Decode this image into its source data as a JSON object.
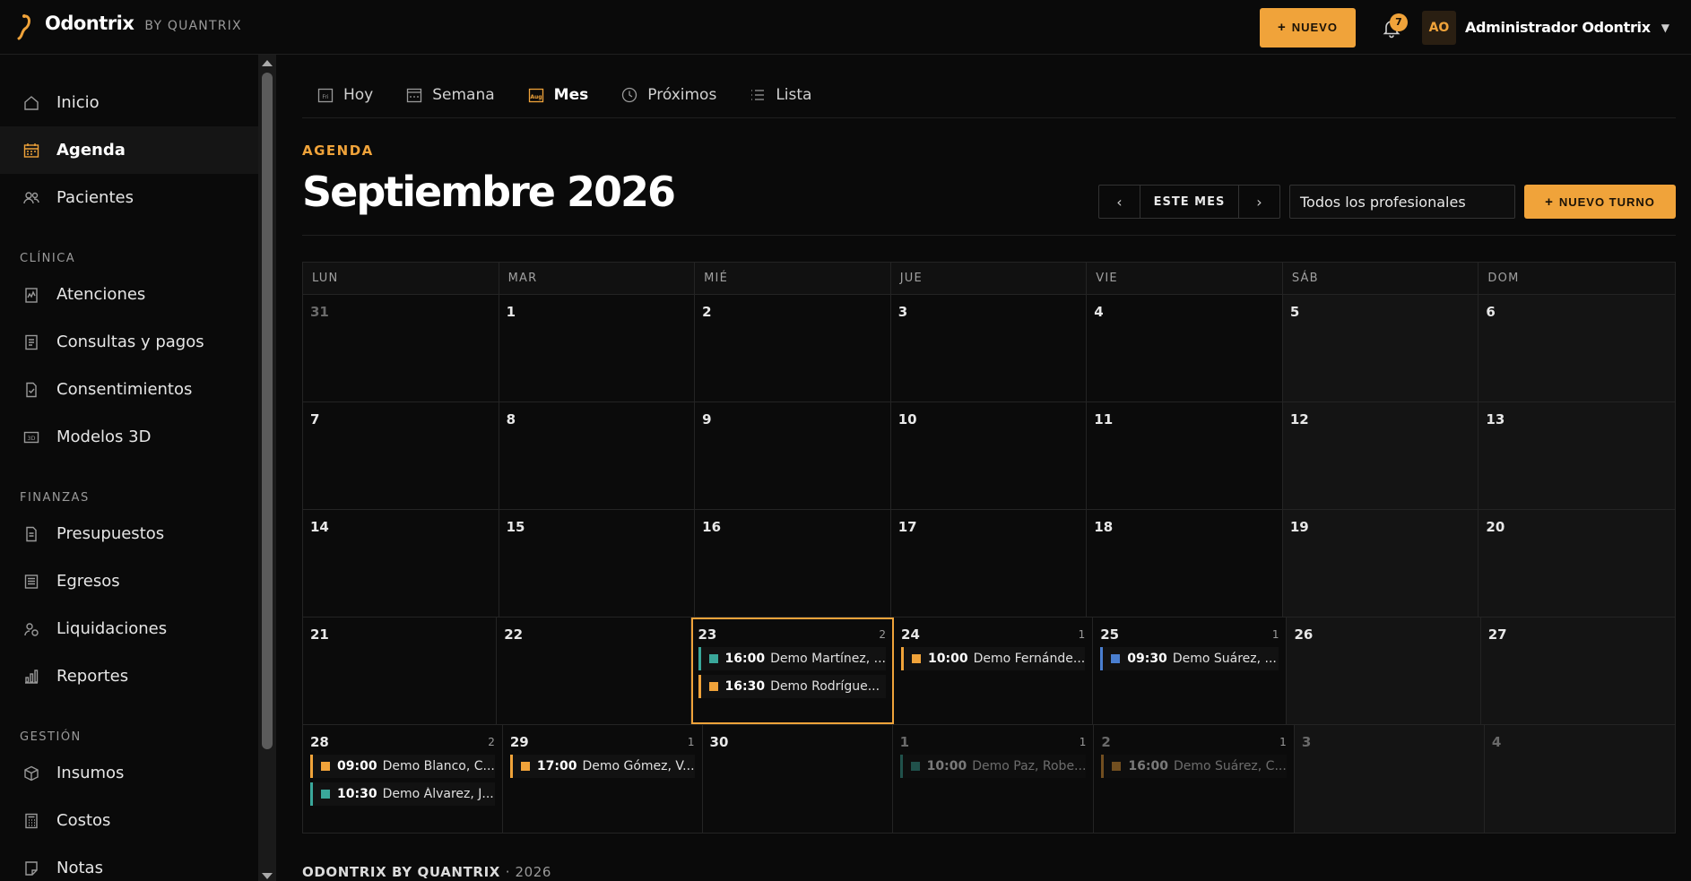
{
  "brand": {
    "name": "Odontrix",
    "by": "BY QUANTRIX"
  },
  "topbar": {
    "new_label": "NUEVO",
    "notifications": "7",
    "avatar_initials": "AO",
    "user_name": "Administrador Odontrix"
  },
  "sidebar": {
    "top_items": [
      {
        "label": "Inicio",
        "icon": "home-icon"
      },
      {
        "label": "Agenda",
        "icon": "calendar-icon",
        "active": true
      },
      {
        "label": "Pacientes",
        "icon": "users-icon"
      }
    ],
    "sections": [
      {
        "title": "CLÍNICA",
        "items": [
          {
            "label": "Atenciones",
            "icon": "clipboard-chart-icon"
          },
          {
            "label": "Consultas y pagos",
            "icon": "receipt-icon"
          },
          {
            "label": "Consentimientos",
            "icon": "document-check-icon"
          },
          {
            "label": "Modelos 3D",
            "icon": "3d-icon"
          }
        ]
      },
      {
        "title": "FINANZAS",
        "items": [
          {
            "label": "Presupuestos",
            "icon": "document-icon"
          },
          {
            "label": "Egresos",
            "icon": "ledger-icon"
          },
          {
            "label": "Liquidaciones",
            "icon": "user-money-icon"
          },
          {
            "label": "Reportes",
            "icon": "bar-chart-icon"
          }
        ]
      },
      {
        "title": "GESTIÓN",
        "items": [
          {
            "label": "Insumos",
            "icon": "box-icon"
          },
          {
            "label": "Costos",
            "icon": "calculator-icon"
          },
          {
            "label": "Notas",
            "icon": "note-icon"
          }
        ]
      }
    ]
  },
  "view_tabs": [
    {
      "label": "Hoy",
      "icon": "day-calendar-icon"
    },
    {
      "label": "Semana",
      "icon": "week-calendar-icon"
    },
    {
      "label": "Mes",
      "icon": "month-calendar-icon",
      "active": true
    },
    {
      "label": "Próximos",
      "icon": "clock-icon"
    },
    {
      "label": "Lista",
      "icon": "list-icon"
    }
  ],
  "header": {
    "eyebrow": "AGENDA",
    "title": "Septiembre 2026",
    "this_month": "ESTE MES",
    "professionals": "Todos los profesionales",
    "new_appointment": "NUEVO TURNO"
  },
  "calendar": {
    "weekdays": [
      "LUN",
      "MAR",
      "MIÉ",
      "JUE",
      "VIE",
      "SÁB",
      "DOM"
    ],
    "weeks": [
      [
        {
          "day": "31",
          "other": true
        },
        {
          "day": "1"
        },
        {
          "day": "2"
        },
        {
          "day": "3"
        },
        {
          "day": "4"
        },
        {
          "day": "5"
        },
        {
          "day": "6"
        }
      ],
      [
        {
          "day": "7"
        },
        {
          "day": "8"
        },
        {
          "day": "9"
        },
        {
          "day": "10"
        },
        {
          "day": "11"
        },
        {
          "day": "12"
        },
        {
          "day": "13"
        }
      ],
      [
        {
          "day": "14"
        },
        {
          "day": "15"
        },
        {
          "day": "16"
        },
        {
          "day": "17"
        },
        {
          "day": "18"
        },
        {
          "day": "19"
        },
        {
          "day": "20"
        }
      ],
      [
        {
          "day": "21"
        },
        {
          "day": "22"
        },
        {
          "day": "23",
          "today": true,
          "count": "2",
          "events": [
            {
              "time": "16:00",
              "who": "Demo Martínez, ...",
              "color": "teal"
            },
            {
              "time": "16:30",
              "who": "Demo Rodrígue...",
              "color": "gold"
            }
          ]
        },
        {
          "day": "24",
          "count": "1",
          "events": [
            {
              "time": "10:00",
              "who": "Demo Fernánde...",
              "color": "gold"
            }
          ]
        },
        {
          "day": "25",
          "count": "1",
          "events": [
            {
              "time": "09:30",
              "who": "Demo Suárez, ...",
              "color": "blue"
            }
          ]
        },
        {
          "day": "26"
        },
        {
          "day": "27"
        }
      ],
      [
        {
          "day": "28",
          "count": "2",
          "events": [
            {
              "time": "09:00",
              "who": "Demo Blanco, C...",
              "color": "gold"
            },
            {
              "time": "10:30",
              "who": "Demo Álvarez, J...",
              "color": "teal"
            }
          ]
        },
        {
          "day": "29",
          "count": "1",
          "events": [
            {
              "time": "17:00",
              "who": "Demo Gómez, V...",
              "color": "gold"
            }
          ]
        },
        {
          "day": "30"
        },
        {
          "day": "1",
          "other": true,
          "count": "1",
          "events": [
            {
              "time": "10:00",
              "who": "Demo Paz, Robe...",
              "color": "teal"
            }
          ]
        },
        {
          "day": "2",
          "other": true,
          "count": "1",
          "events": [
            {
              "time": "16:00",
              "who": "Demo Suárez, C...",
              "color": "gold"
            }
          ]
        },
        {
          "day": "3",
          "other": true
        },
        {
          "day": "4",
          "other": true
        }
      ]
    ]
  },
  "colors": {
    "accent": "#f0a33a",
    "teal": "#3aa79a",
    "blue": "#4a7fd0"
  },
  "footer": {
    "brand": "ODONTRIX BY QUANTRIX",
    "year": "· 2026"
  }
}
